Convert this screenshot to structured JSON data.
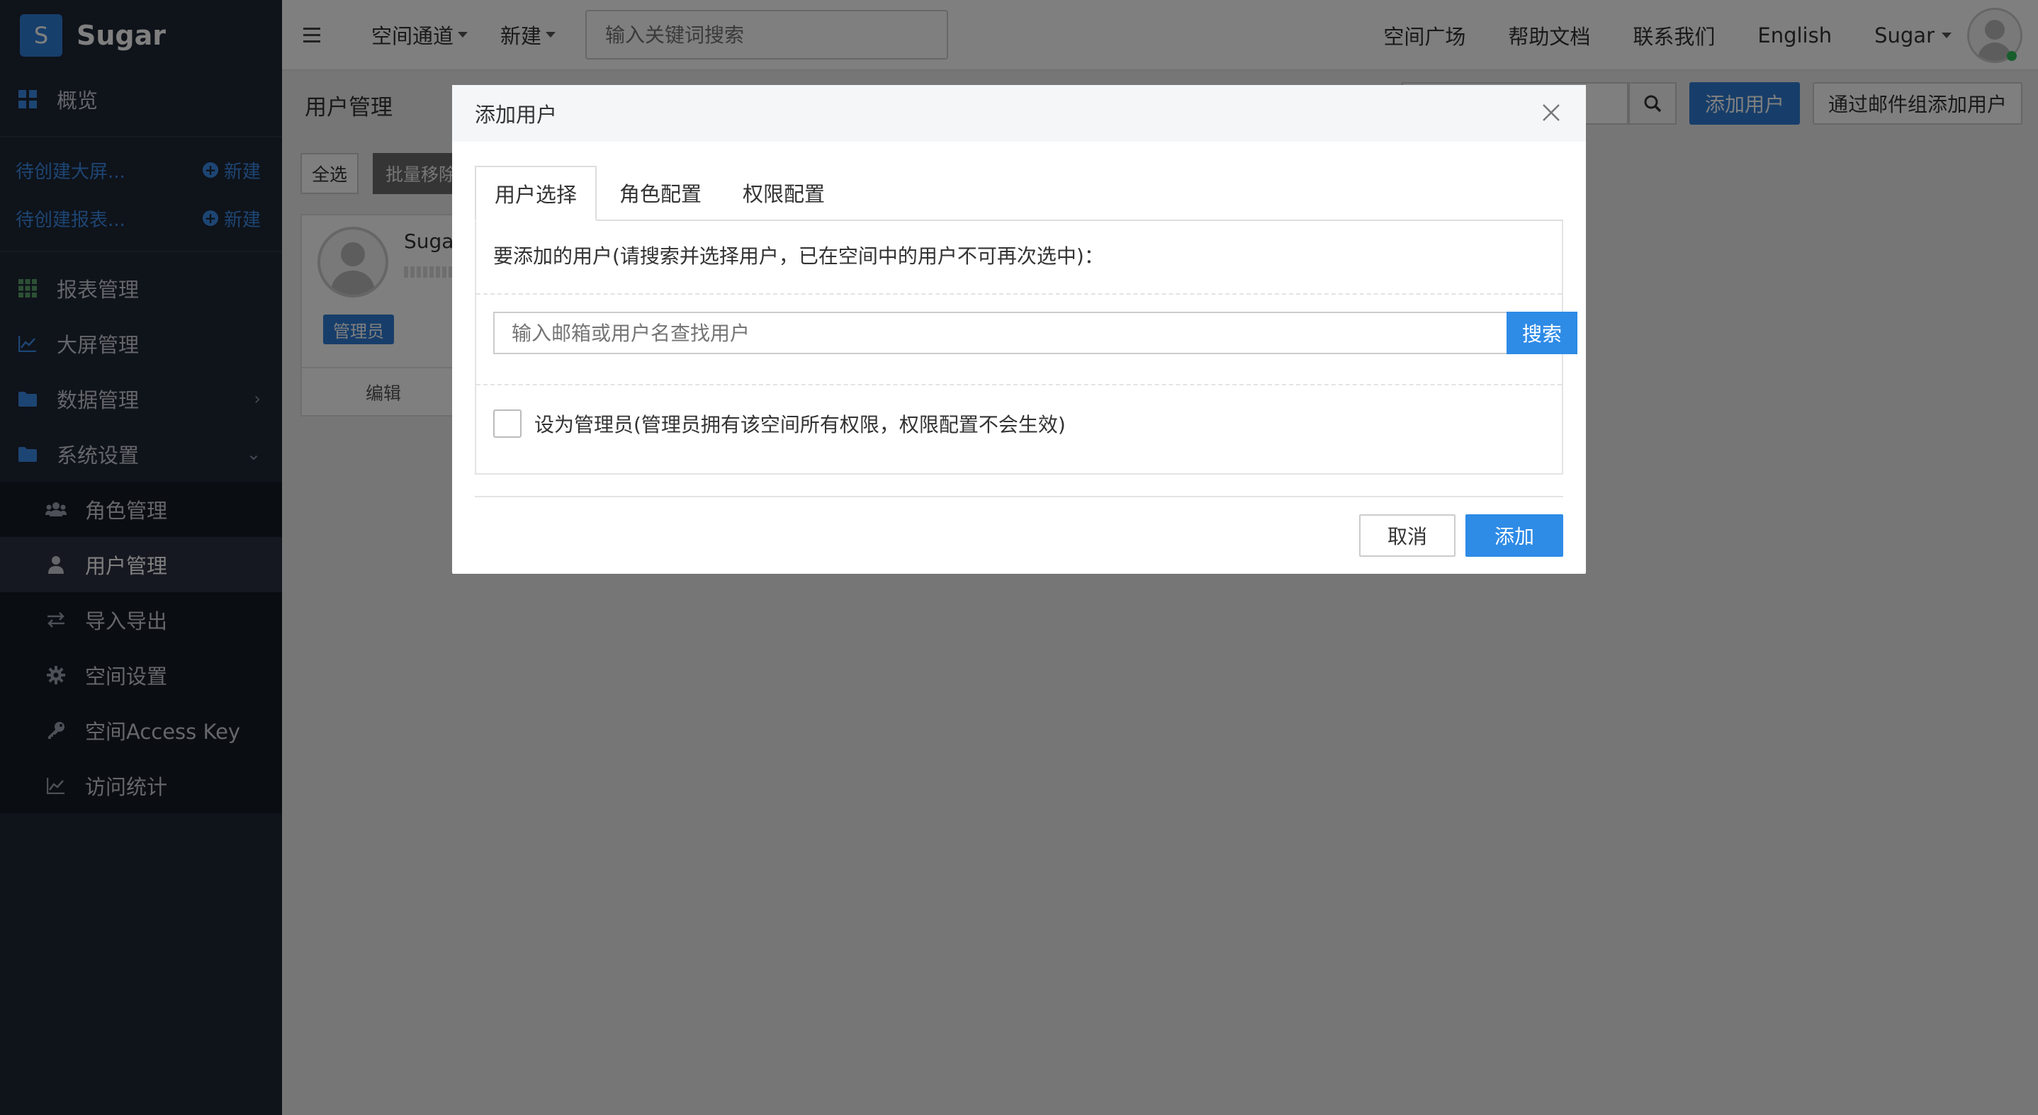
{
  "app": {
    "logo_letter": "S",
    "name": "Sugar"
  },
  "sidebar": {
    "overview_label": "概览",
    "pending": [
      {
        "label": "待创建大屏...",
        "new_label": "新建"
      },
      {
        "label": "待创建报表...",
        "new_label": "新建"
      }
    ],
    "items": [
      {
        "label": "报表管理",
        "icon": "grid-icon"
      },
      {
        "label": "大屏管理",
        "icon": "line-chart-icon"
      },
      {
        "label": "数据管理",
        "icon": "folder-icon"
      },
      {
        "label": "系统设置",
        "icon": "folder-icon"
      }
    ],
    "sub_items": [
      {
        "label": "角色管理",
        "icon": "users-icon"
      },
      {
        "label": "用户管理",
        "icon": "user-icon",
        "active": true
      },
      {
        "label": "导入导出",
        "icon": "exchange-icon"
      },
      {
        "label": "空间设置",
        "icon": "gear-icon"
      },
      {
        "label": "空间Access Key",
        "icon": "key-icon"
      },
      {
        "label": "访问统计",
        "icon": "line-chart-icon"
      }
    ]
  },
  "topbar": {
    "space_channel": "空间通道",
    "new_label": "新建",
    "search_placeholder": "输入关键词搜索",
    "links": [
      "空间广场",
      "帮助文档",
      "联系我们",
      "English"
    ],
    "user_name": "Sugar"
  },
  "page": {
    "title": "用户管理",
    "add_user_button": "添加用户",
    "add_by_group_button": "通过邮件组添加用户",
    "select_all": "全选",
    "batch_remove": "批量移除",
    "card": {
      "name": "Suga",
      "badge": "管理员",
      "footer": "编辑"
    }
  },
  "modal": {
    "title": "添加用户",
    "tabs": [
      "用户选择",
      "角色配置",
      "权限配置"
    ],
    "hint": "要添加的用户(请搜索并选择用户，已在空间中的用户不可再次选中)：",
    "search_placeholder": "输入邮箱或用户名查找用户",
    "search_button": "搜索",
    "admin_checkbox_label": "设为管理员(管理员拥有该空间所有权限，权限配置不会生效)",
    "cancel_button": "取消",
    "add_button": "添加"
  },
  "colors": {
    "primary": "#2e8be6",
    "sidebar_bg": "#1f2634"
  }
}
